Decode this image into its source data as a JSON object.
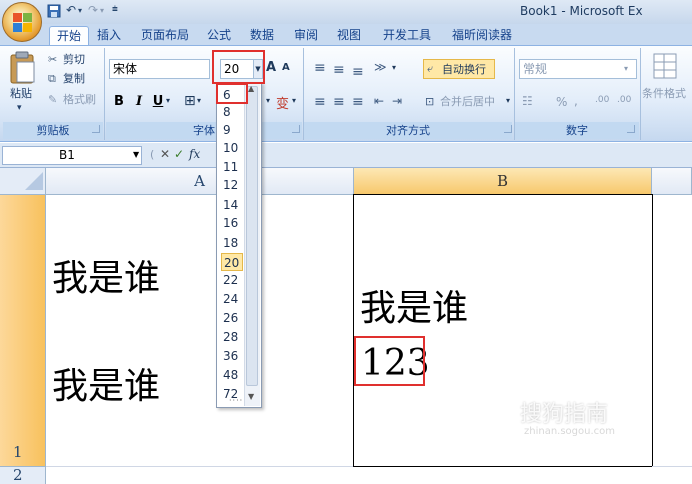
{
  "window": {
    "title": "Book1 - Microsoft Ex"
  },
  "tabs": [
    "开始",
    "插入",
    "页面布局",
    "公式",
    "数据",
    "审阅",
    "视图",
    "开发工具",
    "福昕阅读器"
  ],
  "clipboard": {
    "paste": "粘贴",
    "cut": "剪切",
    "copy": "复制",
    "format_painter": "格式刷",
    "label": "剪贴板"
  },
  "font": {
    "name": "宋体",
    "size": "20",
    "label": "字体",
    "bold": "B",
    "italic": "I",
    "underline": "U",
    "grow": "A",
    "shrink": "A"
  },
  "alignment": {
    "wrap": "自动换行",
    "merge": "合并后居中",
    "label": "对齐方式"
  },
  "number": {
    "format": "常规",
    "percent": "%",
    "label": "数字"
  },
  "styles": {
    "conditional": "条件格式"
  },
  "formula_bar": {
    "name_box": "B1"
  },
  "columns": [
    "A",
    "B"
  ],
  "rows": [
    "1",
    "2"
  ],
  "cells": {
    "a1_line1": "我是谁",
    "a1_line2": "我是谁",
    "b1_line1": "我是谁",
    "b1_line2": "123"
  },
  "font_size_dropdown": {
    "options": [
      "6",
      "8",
      "9",
      "10",
      "11",
      "12",
      "14",
      "16",
      "18",
      "20",
      "22",
      "24",
      "26",
      "28",
      "36",
      "48",
      "72"
    ],
    "selected": "20"
  },
  "watermark": {
    "text": "搜狗指南",
    "url": "zhinan.sogou.com"
  },
  "colors": {
    "selection_accent": "#e0302e",
    "ribbon": "#dbe7f6",
    "selected_header": "#f8c15d"
  }
}
